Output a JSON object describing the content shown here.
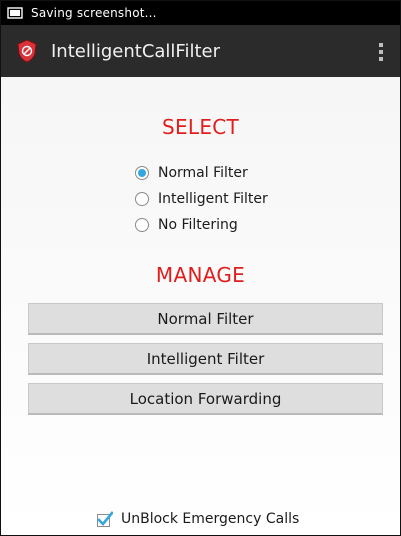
{
  "status_bar": {
    "text": "Saving screenshot...",
    "icon": "screenshot-icon"
  },
  "action_bar": {
    "title": "IntelligentCallFilter",
    "app_icon": "shield-icon",
    "menu_icon": "overflow-menu-icon"
  },
  "select": {
    "title": "SELECT",
    "options": [
      {
        "label": "Normal Filter",
        "selected": true
      },
      {
        "label": "Intelligent Filter",
        "selected": false
      },
      {
        "label": "No Filtering",
        "selected": false
      }
    ]
  },
  "manage": {
    "title": "MANAGE",
    "buttons": [
      {
        "label": "Normal Filter"
      },
      {
        "label": "Intelligent Filter"
      },
      {
        "label": "Location Forwarding"
      }
    ]
  },
  "emergency": {
    "label": "UnBlock Emergency Calls",
    "checked": true
  },
  "colors": {
    "accent": "#33a6dd",
    "section_title": "#e11e1e",
    "action_bar": "#2b2b2b",
    "status_bar": "#000000"
  }
}
